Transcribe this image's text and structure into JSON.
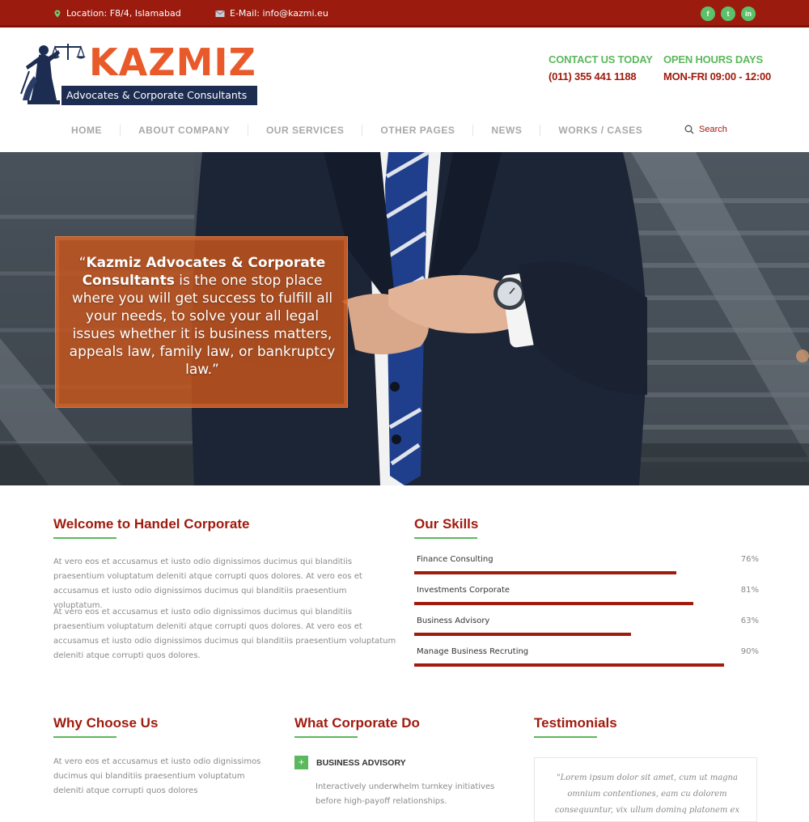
{
  "topbar": {
    "location": "Location: F8/4, Islamabad",
    "email": "E-Mail: info@kazmi.eu",
    "social": [
      "f",
      "t",
      "in"
    ]
  },
  "brand": {
    "name": "KAZMIZ",
    "tagline": "Advocates & Corporate Consultants"
  },
  "contact": {
    "call_label": "CONTACT US TODAY",
    "call_value": "(011) 355 441 1188",
    "hours_label": "OPEN HOURS DAYS",
    "hours_value": "MON-FRI 09:00 - 12:00"
  },
  "nav": {
    "items": [
      "HOME",
      "ABOUT COMPANY",
      "OUR SERVICES",
      "OTHER PAGES",
      "NEWS",
      "WORKS / CASES"
    ],
    "search_label": "Search"
  },
  "hero": {
    "quote_open": "“",
    "quote_bold": "Kazmiz Advocates & Corporate Consultants",
    "quote_rest": " is the one stop place where you will get success to fulfill all your needs, to solve your all legal issues whether it is business matters, appeals law, family law, or bankruptcy law.”"
  },
  "welcome": {
    "title": "Welcome to Handel Corporate",
    "p1": "At vero eos et accusamus et iusto odio dignissimos ducimus qui blanditiis praesentium voluptatum deleniti atque corrupti quos dolores. At vero eos et accusamus et iusto odio dignissimos ducimus qui blanditiis praesentium voluptatum.",
    "p2": "At vero eos et accusamus et iusto odio dignissimos ducimus qui blanditiis praesentium voluptatum deleniti atque corrupti quos dolores. At vero eos et accusamus et iusto odio dignissimos ducimus qui blanditiis praesentium voluptatum deleniti atque corrupti quos dolores."
  },
  "skills": {
    "title": "Our Skills",
    "items": [
      {
        "name": "Finance Consulting",
        "value": 76,
        "label": "76%"
      },
      {
        "name": "Investments Corporate",
        "value": 81,
        "label": "81%"
      },
      {
        "name": "Business Advisory",
        "value": 63,
        "label": "63%"
      },
      {
        "name": "Manage Business Recruting",
        "value": 90,
        "label": "90%"
      }
    ]
  },
  "why": {
    "title": "Why Choose Us",
    "text": "At vero eos et accusamus et iusto odio dignissimos ducimus qui blanditiis praesentium voluptatum deleniti atque corrupti quos dolores"
  },
  "corporate": {
    "title": "What Corporate Do",
    "item_label": "BUSINESS ADVISORY",
    "item_text": "Interactively underwhelm turnkey initiatives before high-payoff relationships."
  },
  "testimonials": {
    "title": "Testimonials",
    "quote": "\"Lorem ipsum dolor sit amet, cum ut magna omnium contentiones, eam cu dolorem consequuntur, vix ullum dominq platonem ex"
  },
  "colors": {
    "brand_red": "#a01b0e",
    "accent_orange": "#e85a2a",
    "accent_green": "#5cb85c",
    "navy": "#1d2d52"
  }
}
